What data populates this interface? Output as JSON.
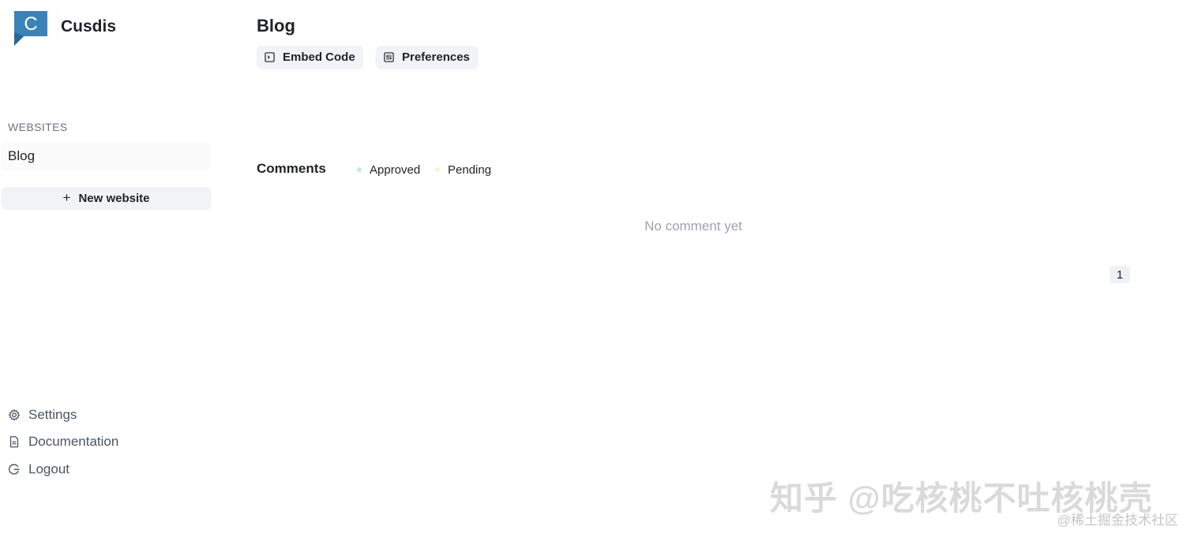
{
  "sidebar": {
    "app_name": "Cusdis",
    "logo_letter": "C",
    "section_label": "WEBSITES",
    "websites": [
      {
        "label": "Blog"
      }
    ],
    "new_website_label": "New website",
    "footer_links": [
      {
        "label": "Settings",
        "icon": "gear-icon"
      },
      {
        "label": "Documentation",
        "icon": "document-icon"
      },
      {
        "label": "Logout",
        "icon": "logout-icon"
      }
    ]
  },
  "main": {
    "title": "Blog",
    "tabs": [
      {
        "label": "Embed Code",
        "icon": "code-icon"
      },
      {
        "label": "Preferences",
        "icon": "preferences-icon"
      }
    ],
    "comments": {
      "title": "Comments",
      "filters": [
        {
          "label": "Approved",
          "color": "#c9ecd9"
        },
        {
          "label": "Pending",
          "color": "#fbf1c4"
        }
      ],
      "empty_message": "No comment yet"
    },
    "pagination": {
      "current_page": "1"
    }
  },
  "colors": {
    "logo_blue": "#3b82b8",
    "button_bg": "#f1f3f6"
  },
  "watermark": {
    "main": "知乎 @吃核桃不吐核桃壳",
    "sub": "@稀土掘金技术社区"
  }
}
